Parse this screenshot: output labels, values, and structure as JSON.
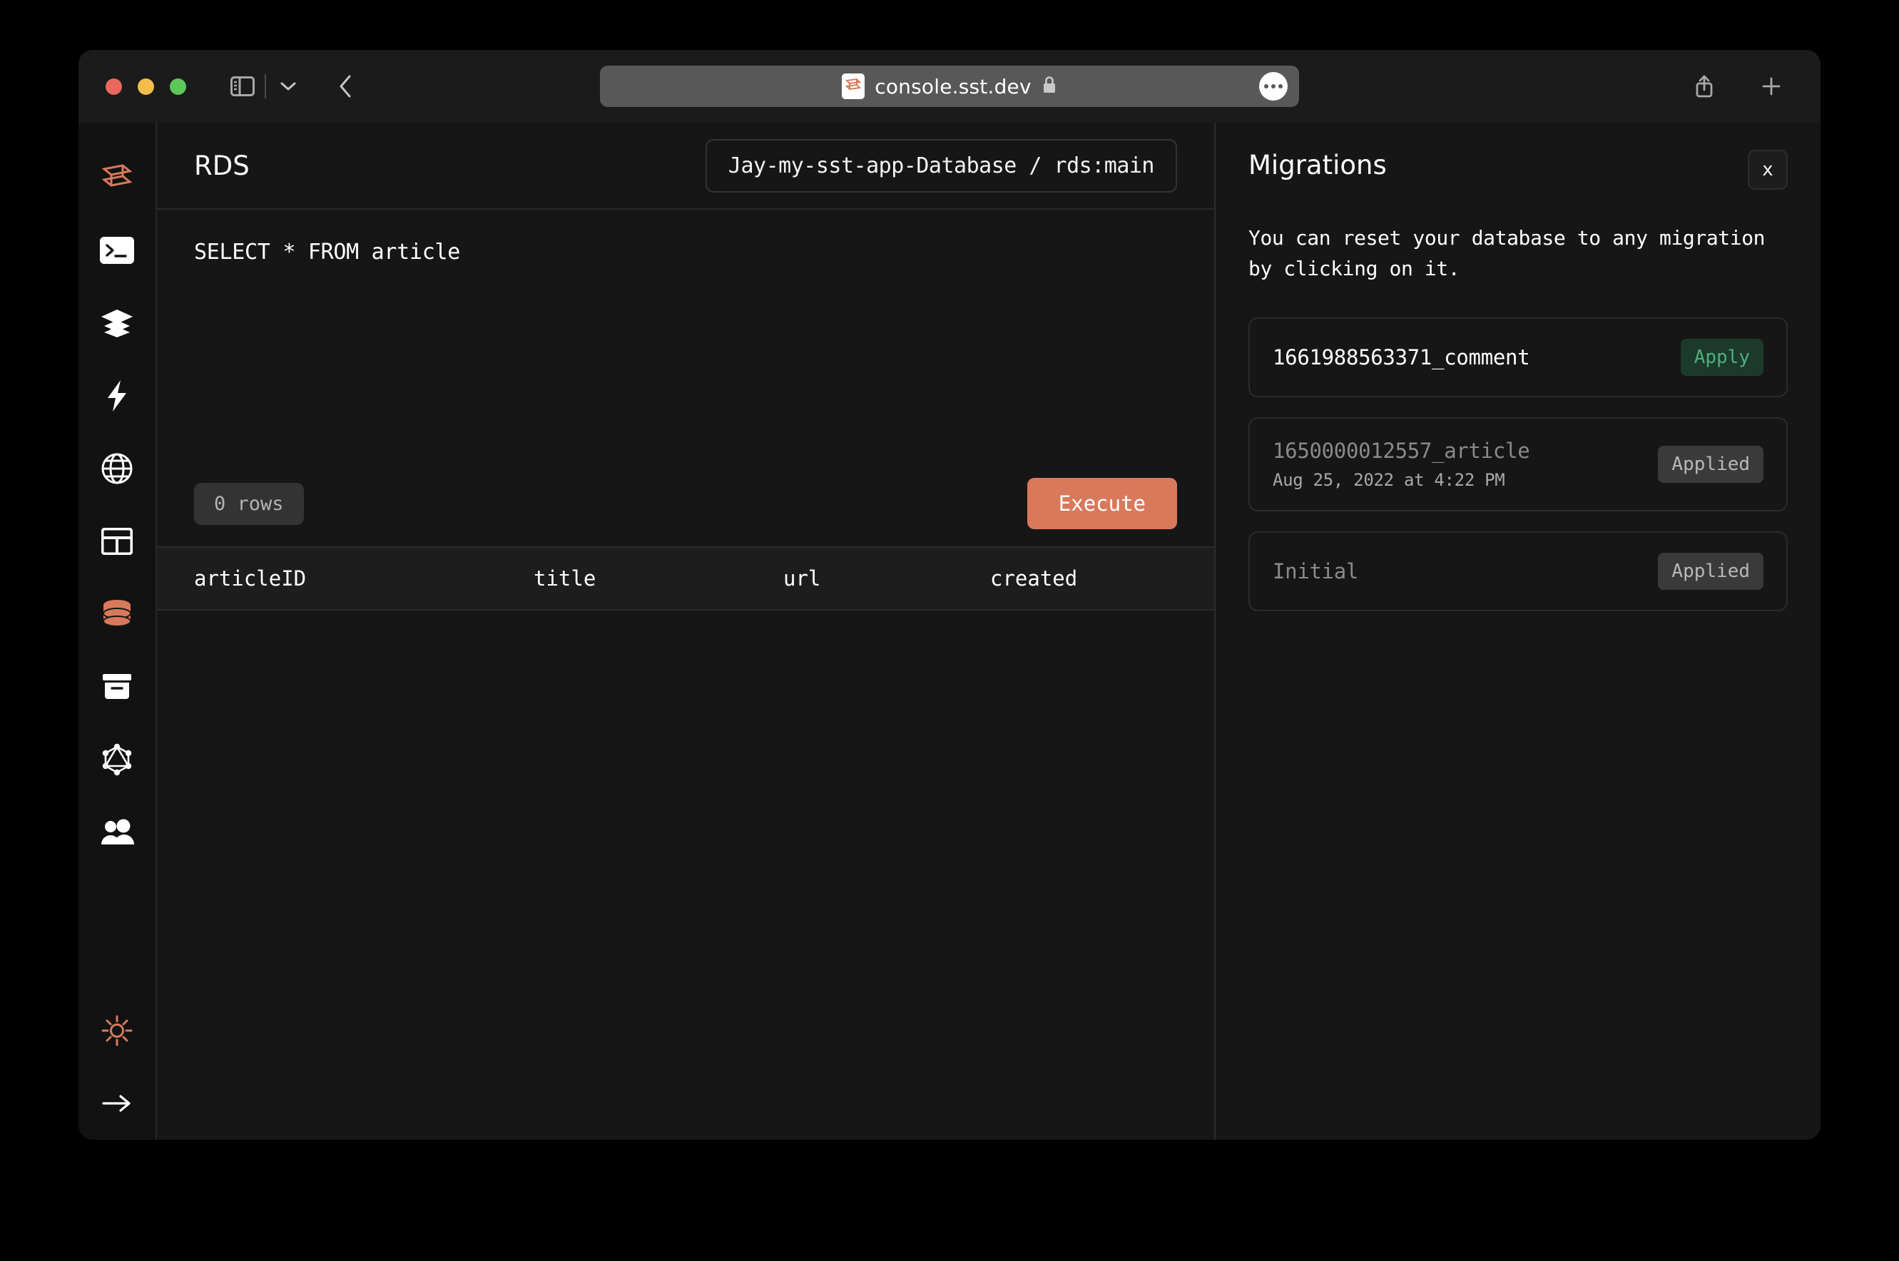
{
  "browser": {
    "url": "console.sst.dev",
    "favicon_icon": "sst-logo-icon",
    "lock_icon": "lock-icon",
    "sidebar_toggle_icon": "sidebar-toggle-icon",
    "chevron_down_icon": "chevron-down-icon",
    "back_icon": "chevron-left-icon",
    "share_icon": "share-icon",
    "new_tab_icon": "plus-icon",
    "more_icon": "ellipsis-icon",
    "traffic_lights": [
      "close",
      "minimize",
      "maximize"
    ]
  },
  "sidebar": {
    "items": [
      {
        "icon": "sst-logo-icon",
        "name": "logo",
        "active": false
      },
      {
        "icon": "terminal-icon",
        "name": "local",
        "active": true
      },
      {
        "icon": "stack-icon",
        "name": "stacks",
        "active": false
      },
      {
        "icon": "lightning-icon",
        "name": "functions",
        "active": false
      },
      {
        "icon": "globe-icon",
        "name": "api",
        "active": false
      },
      {
        "icon": "table-icon",
        "name": "dynamodb",
        "active": false
      },
      {
        "icon": "database-icon",
        "name": "rds",
        "active": true
      },
      {
        "icon": "bucket-icon",
        "name": "buckets",
        "active": false
      },
      {
        "icon": "graphql-icon",
        "name": "graphql",
        "active": false
      },
      {
        "icon": "users-icon",
        "name": "cognito",
        "active": false
      }
    ],
    "bottom_items": [
      {
        "icon": "sun-icon",
        "name": "theme-toggle"
      },
      {
        "icon": "arrow-right-icon",
        "name": "expand-sidebar"
      }
    ]
  },
  "main": {
    "title": "RDS",
    "breadcrumb": "Jay-my-sst-app-Database / rds:main",
    "query": "SELECT * FROM article",
    "rows_badge": "0 rows",
    "execute_label": "Execute",
    "columns": [
      "articleID",
      "title",
      "url",
      "created"
    ],
    "rows": []
  },
  "panel": {
    "title": "Migrations",
    "close_label": "x",
    "description": "You can reset your database to any migration by clicking on it.",
    "migrations": [
      {
        "name": "1661988563371_comment",
        "date": "",
        "status": "Apply",
        "applied": false
      },
      {
        "name": "1650000012557_article",
        "date": "Aug 25, 2022 at 4:22 PM",
        "status": "Applied",
        "applied": true
      },
      {
        "name": "Initial",
        "date": "",
        "status": "Applied",
        "applied": true
      }
    ]
  },
  "colors": {
    "accent": "#d9795c",
    "apply_bg": "#1c3a2b",
    "apply_text": "#4fae80",
    "applied_bg": "#3a3a3a",
    "window_bg": "#161616",
    "sidebar_bg": "#121212"
  }
}
